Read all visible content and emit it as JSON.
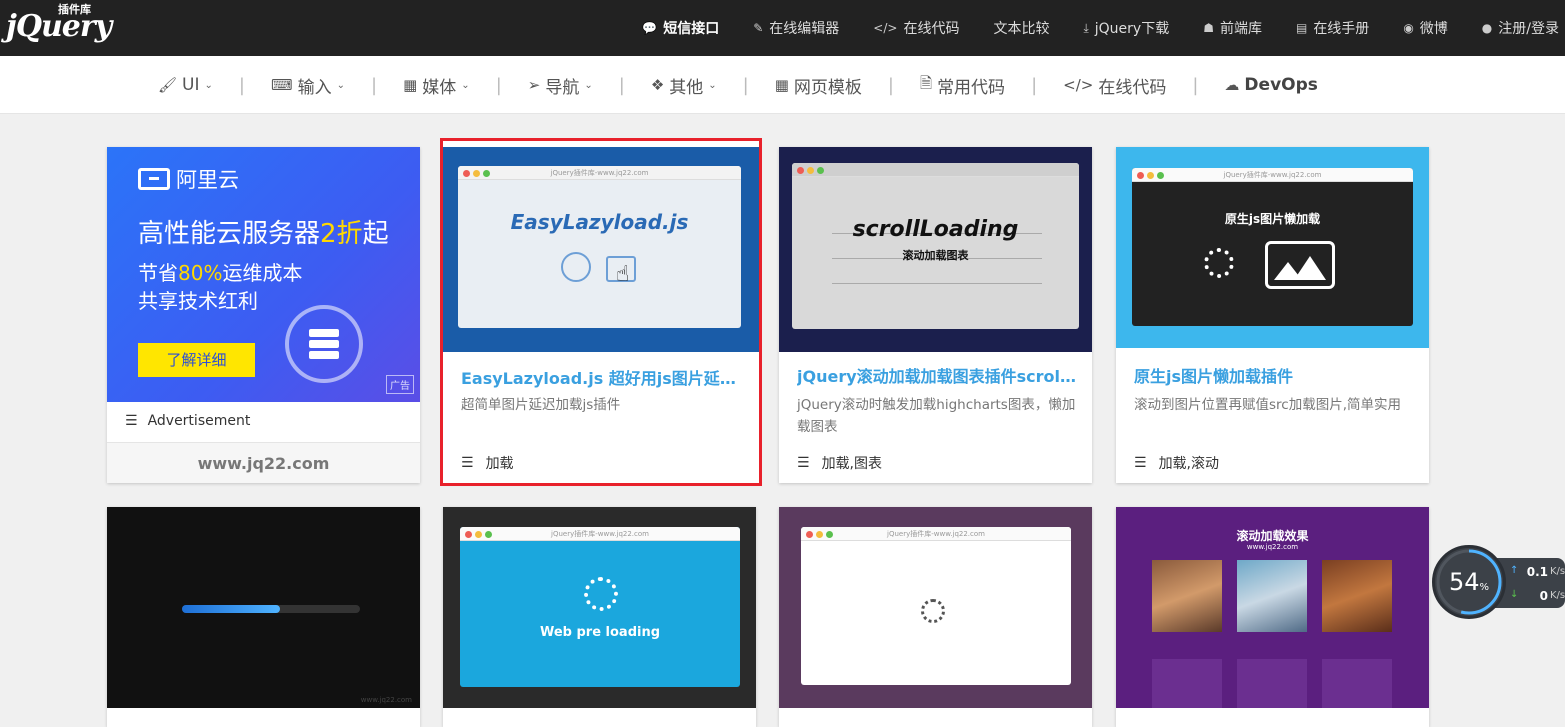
{
  "logo": {
    "text": "jQuery",
    "cn": "插件库"
  },
  "top_links": [
    {
      "label": "短信接口",
      "icon": "comment-icon",
      "bold": true
    },
    {
      "label": "在线编辑器",
      "icon": "edit-icon"
    },
    {
      "label": "在线代码",
      "icon": "code-icon"
    },
    {
      "label": "文本比较",
      "icon": ""
    },
    {
      "label": "jQuery下载",
      "icon": "download-icon"
    },
    {
      "label": "前端库",
      "icon": "user-secret-icon"
    },
    {
      "label": "在线手册",
      "icon": "book-icon"
    },
    {
      "label": "微博",
      "icon": "weibo-icon"
    },
    {
      "label": "注册/登录",
      "icon": "user-icon"
    }
  ],
  "nav": [
    {
      "label": "UI",
      "icon": "brush-icon",
      "dropdown": true
    },
    {
      "label": "输入",
      "icon": "keyboard-icon",
      "dropdown": true
    },
    {
      "label": "媒体",
      "icon": "film-icon",
      "dropdown": true
    },
    {
      "label": "导航",
      "icon": "send-icon",
      "dropdown": true
    },
    {
      "label": "其他",
      "icon": "dropbox-icon",
      "dropdown": true
    },
    {
      "label": "网页模板",
      "icon": "grid-icon",
      "dropdown": false
    },
    {
      "label": "常用代码",
      "icon": "file-code-icon",
      "dropdown": false
    },
    {
      "label": "在线代码",
      "icon": "code-icon",
      "dropdown": false
    },
    {
      "label": "DevOps",
      "icon": "cloud-icon",
      "dropdown": false,
      "bold": true
    }
  ],
  "ad": {
    "brand": "阿里云",
    "headline_a": "高性能云服务器",
    "headline_b": "2折",
    "headline_c": "起",
    "line2_a": "节省",
    "line2_b": "80%",
    "line2_c": "运维成本",
    "line3": "共享技术红利",
    "cta": "了解详细",
    "badge": "广告",
    "footer_label": "Advertisement",
    "site": "www.jq22.com",
    "colors": {
      "bg_start": "#2f6cf6",
      "bg_end": "#4d4ff0",
      "cta": "#ffe600",
      "highlight": "#ffd800"
    }
  },
  "cards": [
    {
      "title": "EasyLazyload.js 超好用js图片延迟...",
      "desc": "超简单图片延迟加载js插件",
      "tags": "加载",
      "thumb_text": "EasyLazyload.js",
      "mock_url": "jQuery插件库-www.jq22.com",
      "selected": true
    },
    {
      "title": "jQuery滚动加载加载图表插件scrol...",
      "desc": "jQuery滚动时触发加载highcharts图表，懒加载图表",
      "tags": "加载,图表",
      "thumb_text": "scrollLoading",
      "thumb_sub": "滚动加载图表"
    },
    {
      "title": "原生js图片懒加载插件",
      "desc": "滚动到图片位置再赋值src加载图片,简单实用",
      "tags": "加载,滚动",
      "thumb_text": "原生js图片懒加载",
      "mock_url": "jQuery插件库-www.jq22.com"
    }
  ],
  "row2": [
    {
      "thumb": "progress-bar",
      "foot": "www.jq22.com"
    },
    {
      "thumb": "web-pre-loading",
      "thumb_text": "Web pre loading",
      "mock_url": "jQuery插件库-www.jq22.com"
    },
    {
      "thumb": "spinner",
      "mock_url": "jQuery插件库-www.jq22.com"
    },
    {
      "thumb": "scroll-effect",
      "thumb_text": "滚动加载效果",
      "thumb_sub": "www.jq22.com"
    }
  ],
  "watermark": "jQuery插件库",
  "net_widget": {
    "percent": "54",
    "percent_unit": "%",
    "up": "0.1",
    "down": "0",
    "unit": "K/s",
    "ring_fraction": 0.54
  }
}
